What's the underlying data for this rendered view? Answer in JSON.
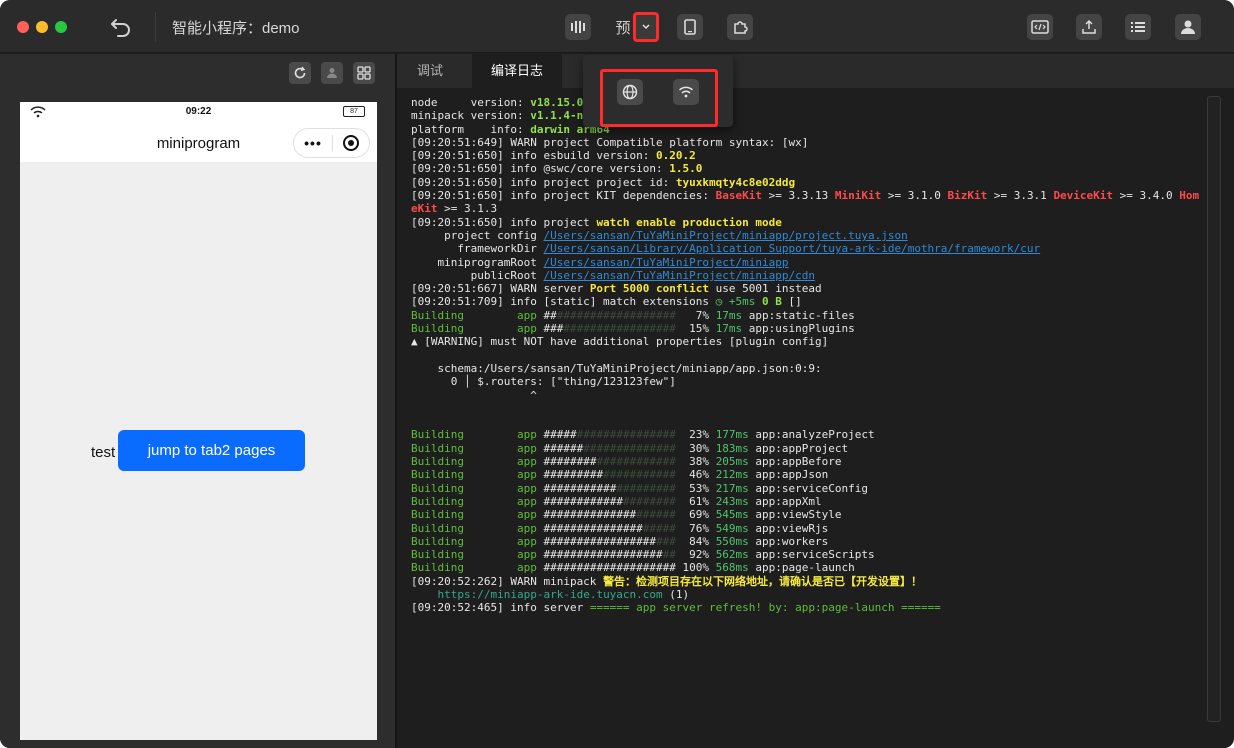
{
  "app": {
    "title": "智能小程序：demo"
  },
  "toolbar": {
    "preview_glyph": "预",
    "dropdown_glyph": "⌄",
    "buttons": [
      "compile-icon",
      "preview-icon",
      "dropdown-icon",
      "device-icon",
      "plugin-icon",
      "code-icon",
      "upload-icon",
      "list-icon",
      "user-icon"
    ]
  },
  "popup": {
    "items": [
      "globe-icon",
      "wifi-icon"
    ]
  },
  "simulator": {
    "status_time": "09:22",
    "battery": "87",
    "nav_title": "miniprogram",
    "capsule_more": "•••",
    "test_label": "test",
    "jump_button": "jump to tab2 pages"
  },
  "tabs": {
    "debug": "调试",
    "log": "编译日志"
  },
  "colors": {
    "accent_blue": "#0a6cff",
    "highlight_red": "#ff2a2a",
    "log_green": "#5fbd3a",
    "log_yellow": "#f5e93c",
    "log_red": "#ff4a4a",
    "link_blue": "#2e8ad8"
  },
  "log": {
    "l1a": "node     version: ",
    "l1b": "v18.15.0",
    "l2a": "minipack version: ",
    "l2b": "v1.1.4-n",
    "l3a": "platform    info: ",
    "l3b": "darwin arm64",
    "l4": "[09:20:51:649] WARN project Compatible platform syntax: [wx]",
    "l5a": "[09:20:51:650] info esbuild version: ",
    "l5b": "0.20.2",
    "l6a": "[09:20:51:650] info @swc/core version: ",
    "l6b": "1.5.0",
    "l7a": "[09:20:51:650] info project project id: ",
    "l7b": "tyuxkmqty4c8e02ddg",
    "l8a": "[09:20:51:650] info project KIT dependencies: ",
    "l8b": "BaseKit",
    "l8c": " >= 3.3.13 ",
    "l8d": "MiniKit",
    "l8e": " >= 3.1.0 ",
    "l8f": "BizKit",
    "l8g": " >= 3.3.1 ",
    "l8h": "DeviceKit",
    "l8i": " >= 3.4.0 ",
    "l8j": "Hom",
    "l9a": "eKit",
    "l9b": " >= 3.1.3",
    "l10a": "[09:20:51:650] info project ",
    "l10b": "watch enable production mode",
    "l11a": "     project config ",
    "l11b": "/Users/sansan/TuYaMiniProject/miniapp/project.tuya.json",
    "l12a": "       frameworkDir ",
    "l12b": "/Users/sansan/Library/Application Support/tuya-ark-ide/mothra/framework/cur",
    "l13a": "    miniprogramRoot ",
    "l13b": "/Users/sansan/TuYaMiniProject/miniapp",
    "l14a": "         publicRoot ",
    "l14b": "/Users/sansan/TuYaMiniProject/miniapp/cdn",
    "l15a": "[09:20:51:667] WARN server ",
    "l15b": "Port 5000 conflict",
    "l15c": " use 5001 instead",
    "l16a": "[09:20:51:709] info [static] match extensions ",
    "l16b": "◷ +5ms",
    "l16c": " ",
    "l16d": "0 B",
    "l16e": " []",
    "b1": [
      "Building",
      "        app ",
      "##",
      "##################",
      "   7% ",
      "17ms",
      " app:static-files"
    ],
    "b2": [
      "Building",
      "        app ",
      "###",
      "#################",
      "  15% ",
      "17ms",
      " app:usingPlugins"
    ],
    "warn": "▲ [WARNING] must NOT have additional properties [plugin config]",
    "schema": "    schema:/Users/sansan/TuYaMiniProject/miniapp/app.json:0:9:",
    "router": "      0 │ $.routers: [\"thing/123123few\"]",
    "caret": "                  ^",
    "builds": [
      [
        "Building",
        "        app ",
        "#####",
        "###############",
        "  23% ",
        "177ms",
        " app:analyzeProject"
      ],
      [
        "Building",
        "        app ",
        "######",
        "##############",
        "  30% ",
        "183ms",
        " app:appProject"
      ],
      [
        "Building",
        "        app ",
        "########",
        "############",
        "  38% ",
        "205ms",
        " app:appBefore"
      ],
      [
        "Building",
        "        app ",
        "#########",
        "###########",
        "  46% ",
        "212ms",
        " app:appJson"
      ],
      [
        "Building",
        "        app ",
        "###########",
        "#########",
        "  53% ",
        "217ms",
        " app:serviceConfig"
      ],
      [
        "Building",
        "        app ",
        "############",
        "########",
        "  61% ",
        "243ms",
        " app:appXml"
      ],
      [
        "Building",
        "        app ",
        "##############",
        "######",
        "  69% ",
        "545ms",
        " app:viewStyle"
      ],
      [
        "Building",
        "        app ",
        "###############",
        "#####",
        "  76% ",
        "549ms",
        " app:viewRjs"
      ],
      [
        "Building",
        "        app ",
        "#################",
        "###",
        "  84% ",
        "550ms",
        " app:workers"
      ],
      [
        "Building",
        "        app ",
        "##################",
        "##",
        "  92% ",
        "562ms",
        " app:serviceScripts"
      ],
      [
        "Building",
        "        app ",
        "####################",
        "",
        " 100% ",
        "568ms",
        " app:page-launch"
      ]
    ],
    "l30a": "[09:20:52:262] WARN minipack ",
    "l30b": "警告：检测项目存在以下网络地址，请确认是否已【开发设置】！",
    "l31a": "    ",
    "l31b": "https://miniapp-ark-ide.tuyacn.com",
    "l31c": " (1)",
    "l32a": "[09:20:52:465] info server ",
    "l32b": "====== app server refresh! by: app:page-launch ======"
  }
}
